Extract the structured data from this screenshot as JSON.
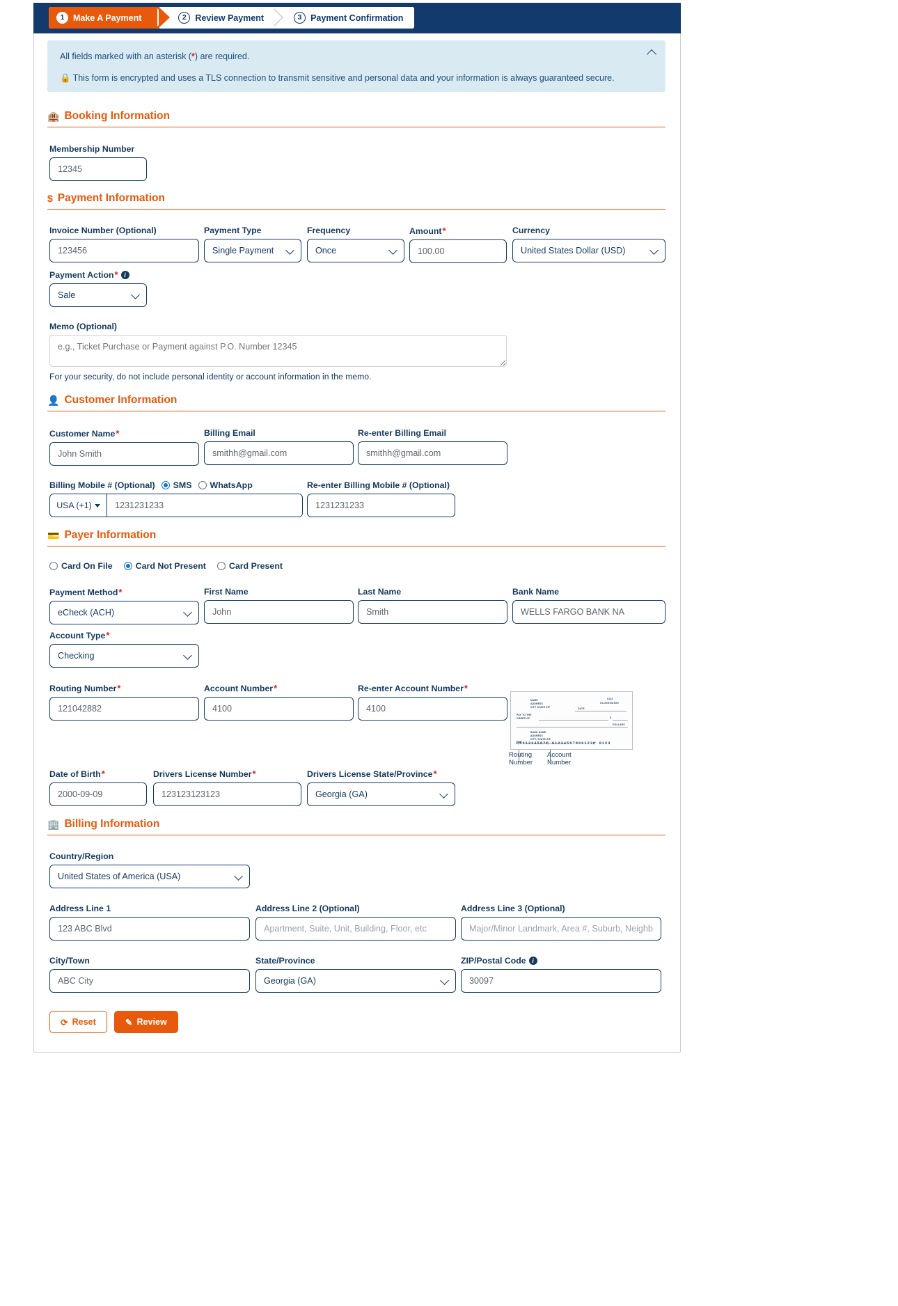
{
  "stepper": {
    "steps": [
      {
        "num": "1",
        "label": "Make A Payment"
      },
      {
        "num": "2",
        "label": "Review Payment"
      },
      {
        "num": "3",
        "label": "Payment Confirmation"
      }
    ]
  },
  "notice": {
    "required_text_before": "All fields marked with an asterisk (",
    "asterisk": "*",
    "required_text_after": ") are required.",
    "security_text": "This form is encrypted and uses a TLS connection to transmit sensitive and personal data and your information is always guaranteed secure."
  },
  "booking": {
    "section_title": "Booking Information",
    "membership_number_label": "Membership Number",
    "membership_number_value": "12345"
  },
  "payment": {
    "section_title": "Payment Information",
    "invoice_label": "Invoice Number (Optional)",
    "invoice_value": "123456",
    "payment_type_label": "Payment Type",
    "payment_type_value": "Single Payment",
    "frequency_label": "Frequency",
    "frequency_value": "Once",
    "amount_label": "Amount",
    "amount_value": "100.00",
    "currency_label": "Currency",
    "currency_value": "United States Dollar (USD)",
    "payment_action_label": "Payment Action",
    "payment_action_value": "Sale",
    "memo_label": "Memo (Optional)",
    "memo_placeholder": "e.g., Ticket Purchase or Payment against P.O. Number 12345",
    "memo_helper": "For your security, do not include personal identity or account information in the memo."
  },
  "customer": {
    "section_title": "Customer Information",
    "customer_name_label": "Customer Name",
    "customer_name_value": "John Smith",
    "billing_email_label": "Billing Email",
    "billing_email_value": "smithh@gmail.com",
    "reenter_email_label": "Re-enter Billing Email",
    "reenter_email_value": "smithh@gmail.com",
    "mobile_label": "Billing Mobile # (Optional)",
    "sms_label": "SMS",
    "whatsapp_label": "WhatsApp",
    "country_code": "USA (+1)",
    "mobile_value": "1231231233",
    "reenter_mobile_label": "Re-enter Billing Mobile # (Optional)",
    "reenter_mobile_value": "1231231233"
  },
  "payer": {
    "section_title": "Payer Information",
    "card_on_file_label": "Card On File",
    "card_not_present_label": "Card Not Present",
    "card_present_label": "Card Present",
    "payment_method_label": "Payment Method",
    "payment_method_value": "eCheck (ACH)",
    "first_name_label": "First Name",
    "first_name_value": "John",
    "last_name_label": "Last Name",
    "last_name_value": "Smith",
    "bank_name_label": "Bank Name",
    "bank_name_value": "WELLS FARGO BANK NA",
    "account_type_label": "Account Type",
    "account_type_value": "Checking",
    "routing_label": "Routing Number",
    "routing_value": "121042882",
    "account_label": "Account Number",
    "account_value": "4100",
    "reenter_account_label": "Re-enter Account Number",
    "reenter_account_value": "4100",
    "check_routing_caption": "Routing\nNumber",
    "check_account_caption": "Account\nNumber",
    "check_micr": "⑆061234567⑆ 01234567890123⑈ 0123",
    "dob_label": "Date of Birth",
    "dob_value": "2000-09-09",
    "dl_number_label": "Drivers License Number",
    "dl_number_value": "123123123123",
    "dl_state_label": "Drivers License State/Province",
    "dl_state_value": "Georgia (GA)"
  },
  "billing": {
    "section_title": "Billing Information",
    "country_label": "Country/Region",
    "country_value": "United States of America (USA)",
    "address1_label": "Address Line 1",
    "address1_value": "123 ABC Blvd",
    "address2_label": "Address Line 2 (Optional)",
    "address2_placeholder": "Apartment, Suite, Unit, Building, Floor, etc",
    "address3_label": "Address Line 3 (Optional)",
    "address3_placeholder": "Major/Minor Landmark, Area #, Suburb, Neighbor",
    "city_label": "City/Town",
    "city_value": "ABC City",
    "state_label": "State/Province",
    "state_value": "Georgia (GA)",
    "zip_label": "ZIP/Postal Code",
    "zip_value": "30097"
  },
  "actions": {
    "reset_label": "Reset",
    "review_label": "Review"
  },
  "colors": {
    "accent_orange": "#e8590c",
    "navy": "#123a6d",
    "notice_bg": "#d9eaf2",
    "required_red": "#e02020"
  }
}
